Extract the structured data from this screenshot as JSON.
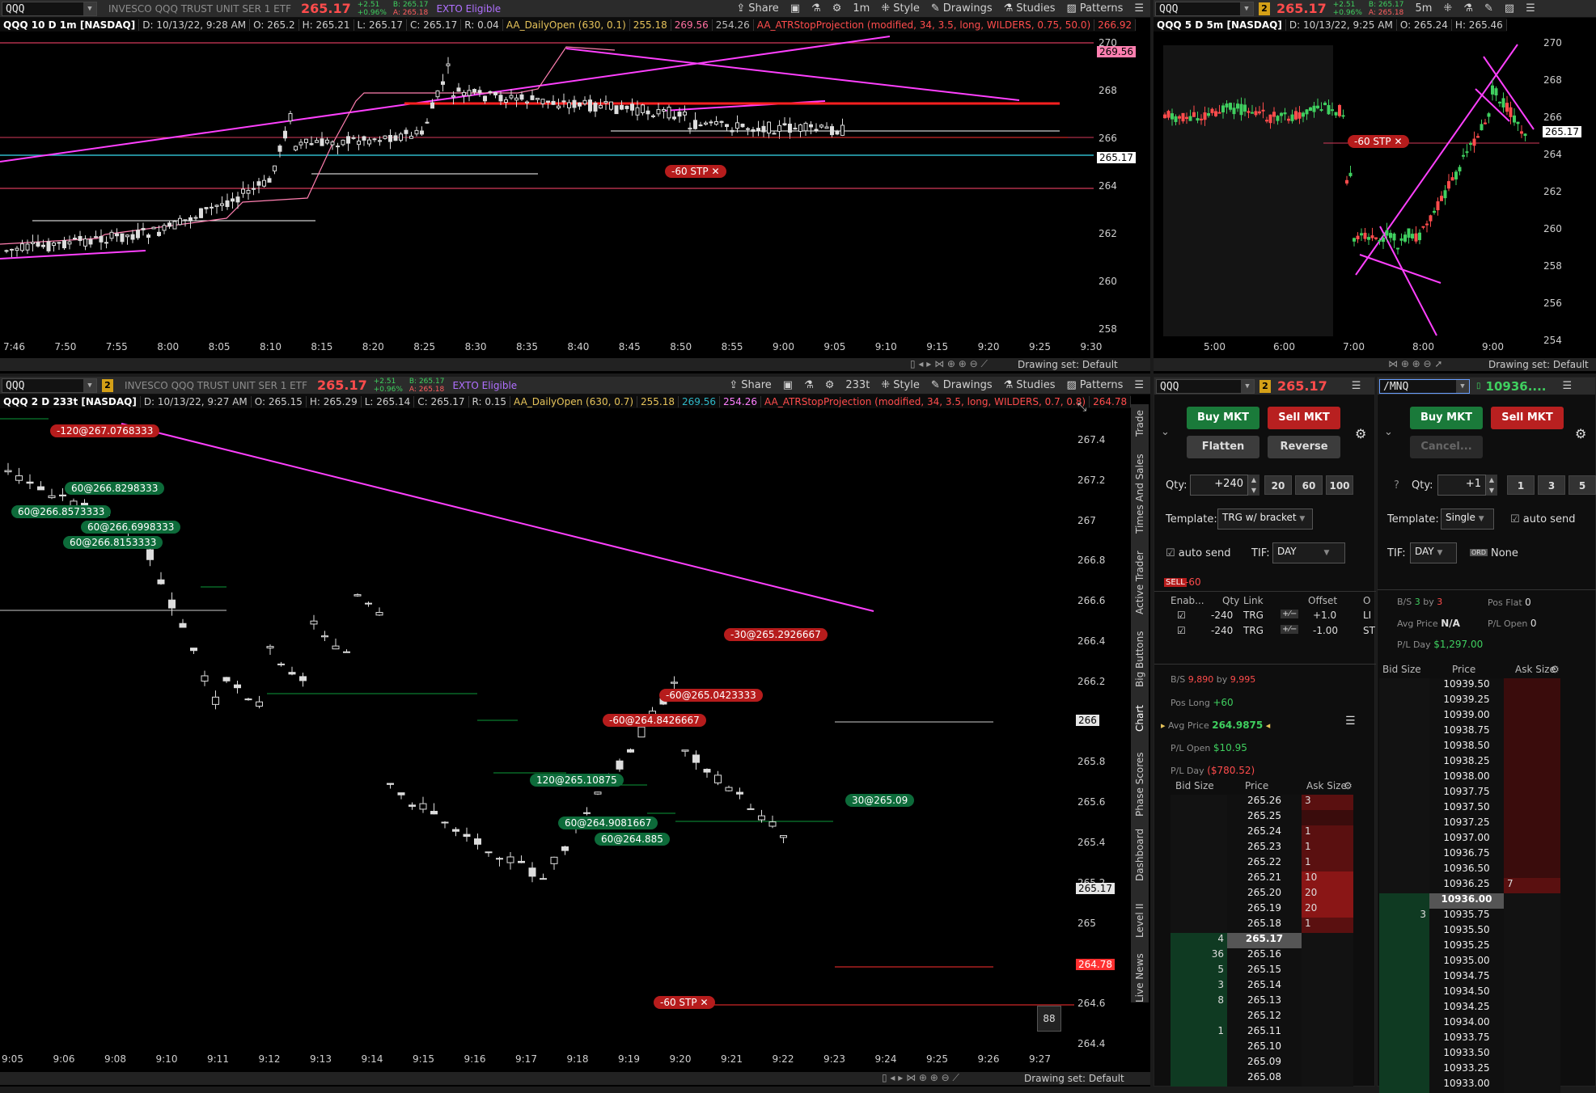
{
  "top_left": {
    "symbol": "QQQ",
    "description": "INVESCO QQQ TRUST UNIT SER 1 ETF",
    "last": "265.17",
    "change": "+2.51",
    "change_pct": "+0.96%",
    "bid": "B: 265.17",
    "ask": "A: 265.18",
    "exto": "EXTO Eligible",
    "toolbar": {
      "share": "Share",
      "interval": "1m",
      "style": "Style",
      "drawings": "Drawings",
      "studies": "Studies",
      "patterns": "Patterns"
    },
    "info": {
      "title": "QQQ 10 D 1m [NASDAQ]",
      "date": "D: 10/13/22, 9:28 AM",
      "open": "O: 265.2",
      "high": "H: 265.21",
      "low": "L: 265.17",
      "close": "C: 265.17",
      "range": "R: 0.04",
      "study1": "AA_DailyOpen (630, 0.1)",
      "s1v1": "255.18",
      "s1v2": "269.56",
      "s1v3": "254.26",
      "study2": "AA_ATRStopProjection (modified, 34, 3.5, long, WILDERS, 0.75, 50.0)",
      "s2v": "266.92"
    },
    "y_labels": [
      "270",
      "268",
      "266",
      "264",
      "262",
      "260",
      "258"
    ],
    "x_labels": [
      "7:46",
      "7:50",
      "7:55",
      "8:00",
      "8:05",
      "8:10",
      "8:15",
      "8:20",
      "8:25",
      "8:30",
      "8:35",
      "8:40",
      "8:45",
      "8:50",
      "8:55",
      "9:00",
      "9:05",
      "9:10",
      "9:15",
      "9:20",
      "9:25",
      "9:30"
    ],
    "price_tag_top": "269.56",
    "price_tag_last": "265.17",
    "stop_tag": "-60 STP",
    "drawing_set": "Drawing set: Default"
  },
  "top_right": {
    "symbol": "QQQ",
    "link": "2",
    "last": "265.17",
    "change": "+2.51",
    "change_pct": "+0.96%",
    "bid": "B: 265.17",
    "ask": "A: 265.18",
    "interval": "5m",
    "info": {
      "title": "QQQ 5 D 5m [NASDAQ]",
      "date": "D: 10/13/22, 9:25 AM",
      "open": "O: 265.24",
      "high": "H: 265.46"
    },
    "y_labels": [
      "270",
      "268",
      "266",
      "264",
      "262",
      "260",
      "258",
      "256",
      "254"
    ],
    "x_labels": [
      "5:00",
      "6:00",
      "7:00",
      "8:00",
      "9:00"
    ],
    "price_tag_last": "265.17",
    "stop_tag": "-60 STP",
    "drawing_set": "Drawing set: Default"
  },
  "bottom": {
    "symbol": "QQQ",
    "link": "2",
    "description": "INVESCO QQQ TRUST UNIT SER 1 ETF",
    "last": "265.17",
    "change": "+2.51",
    "change_pct": "+0.96%",
    "bid": "B: 265.17",
    "ask": "A: 265.18",
    "exto": "EXTO Eligible",
    "toolbar": {
      "share": "Share",
      "interval": "233t",
      "style": "Style",
      "drawings": "Drawings",
      "studies": "Studies",
      "patterns": "Patterns"
    },
    "info": {
      "title": "QQQ 2 D 233t [NASDAQ]",
      "date": "D: 10/13/22, 9:27 AM",
      "open": "O: 265.15",
      "high": "H: 265.29",
      "low": "L: 265.14",
      "close": "C: 265.17",
      "range": "R: 0.15",
      "study1": "AA_DailyOpen (630, 0.7)",
      "s1v1": "255.18",
      "s1v2": "269.56",
      "s1v3": "254.26",
      "study2": "AA_ATRStopProjection (modified, 34, 3.5, long, WILDERS, 0.7, 0.8)",
      "s2v": "264.78"
    },
    "y_labels": [
      "267.4",
      "267.2",
      "267",
      "266.8",
      "266.6",
      "266.4",
      "266.2",
      "266",
      "265.8",
      "265.6",
      "265.4",
      "265.2",
      "265",
      "264.8",
      "264.6",
      "264.4"
    ],
    "x_labels": [
      "9:05",
      "9:06",
      "9:08",
      "9:10",
      "9:11",
      "9:12",
      "9:13",
      "9:14",
      "9:15",
      "9:16",
      "9:17",
      "9:18",
      "9:19",
      "9:20",
      "9:21",
      "9:22",
      "9:23",
      "9:24",
      "9:25",
      "9:26",
      "9:27"
    ],
    "tag_266": "266",
    "tag_last": "265.17",
    "tag_stop": "264.78",
    "stop_tag": "-60 STP",
    "fills": [
      {
        "text": "-120@267.0768333",
        "kind": "r"
      },
      {
        "text": "60@266.8298333",
        "kind": "g"
      },
      {
        "text": "60@266.8573333",
        "kind": "g"
      },
      {
        "text": "60@266.6998333",
        "kind": "g"
      },
      {
        "text": "60@266.8153333",
        "kind": "g"
      },
      {
        "text": "-30@265.2926667",
        "kind": "r"
      },
      {
        "text": "-60@265.0423333",
        "kind": "r"
      },
      {
        "text": "-60@264.8426667",
        "kind": "r"
      },
      {
        "text": "120@265.10875",
        "kind": "g"
      },
      {
        "text": "30@265.09",
        "kind": "g"
      },
      {
        "text": "60@264.9081667",
        "kind": "g"
      },
      {
        "text": "60@264.885",
        "kind": "g"
      }
    ],
    "count_badge": "88",
    "drawing_set": "Drawing set: Default"
  },
  "side_tabs": [
    "Trade",
    "Times And Sales",
    "Active Trader",
    "Big Buttons",
    "Chart",
    "Phase Scores",
    "Dashboard",
    "Level II",
    "Live News"
  ],
  "trader_left": {
    "symbol": "QQQ",
    "link": "2",
    "last": "265.17",
    "buy": "Buy MKT",
    "sell": "Sell MKT",
    "flatten": "Flatten",
    "reverse": "Reverse",
    "qty_label": "Qty:",
    "qty": "+240",
    "qty_presets": [
      "20",
      "60",
      "100"
    ],
    "template_label": "Template:",
    "template": "TRG w/ bracket",
    "auto_send": "auto send",
    "tif_label": "TIF:",
    "tif": "DAY",
    "sell_badge": "SELL",
    "sell_qty": "-60",
    "order_table": {
      "headers": [
        "Enab...",
        "Qty",
        "Link",
        "Offset",
        "O"
      ],
      "rows": [
        {
          "qty": "-240",
          "link": "TRG",
          "offset": "+1.0",
          "o": "LI"
        },
        {
          "qty": "-240",
          "link": "TRG",
          "offset": "-1.00",
          "o": "ST"
        }
      ]
    },
    "bs": "B/S",
    "bs_buy": "9,890",
    "bs_by": "by",
    "bs_sell": "9,995",
    "pos_long_label": "Pos Long",
    "pos_long": "+60",
    "avg_price_label": "Avg Price",
    "avg_price": "264.9875",
    "pl_open_label": "P/L Open",
    "pl_open": "$10.95",
    "pl_day_label": "P/L Day",
    "pl_day": "($780.52)",
    "ladder_headers": [
      "Bid Size",
      "Price",
      "Ask Size"
    ],
    "ladder": [
      {
        "bid": "",
        "price": "265.26",
        "ask": "3"
      },
      {
        "bid": "",
        "price": "265.25",
        "ask": ""
      },
      {
        "bid": "",
        "price": "265.24",
        "ask": "1"
      },
      {
        "bid": "",
        "price": "265.23",
        "ask": "1"
      },
      {
        "bid": "",
        "price": "265.22",
        "ask": "1"
      },
      {
        "bid": "",
        "price": "265.21",
        "ask": "10"
      },
      {
        "bid": "",
        "price": "265.20",
        "ask": "20"
      },
      {
        "bid": "",
        "price": "265.19",
        "ask": "20"
      },
      {
        "bid": "",
        "price": "265.18",
        "ask": "1"
      },
      {
        "bid": "4",
        "price": "265.17",
        "ask": ""
      },
      {
        "bid": "36",
        "price": "265.16",
        "ask": ""
      },
      {
        "bid": "5",
        "price": "265.15",
        "ask": ""
      },
      {
        "bid": "3",
        "price": "265.14",
        "ask": ""
      },
      {
        "bid": "8",
        "price": "265.13",
        "ask": ""
      },
      {
        "bid": "",
        "price": "265.12",
        "ask": ""
      },
      {
        "bid": "1",
        "price": "265.11",
        "ask": ""
      },
      {
        "bid": "",
        "price": "265.10",
        "ask": ""
      },
      {
        "bid": "",
        "price": "265.09",
        "ask": ""
      },
      {
        "bid": "",
        "price": "265.08",
        "ask": ""
      }
    ]
  },
  "trader_right": {
    "symbol": "/MNQ",
    "last": "10936....",
    "buy": "Buy MKT",
    "sell": "Sell MKT",
    "cancel": "Cancel...",
    "qty_label": "Qty:",
    "qty": "+1",
    "qty_presets": [
      "1",
      "3",
      "5"
    ],
    "template_label": "Template:",
    "template": "Single",
    "auto_send": "auto send",
    "tif_label": "TIF:",
    "tif": "DAY",
    "ord_badge": "ORD",
    "ord_text": "None",
    "bs": "B/S",
    "bs_buy": "3",
    "bs_by": "by",
    "bs_sell": "3",
    "pos_flat_label": "Pos Flat",
    "pos_flat": "0",
    "avg_price_label": "Avg Price",
    "avg_price": "N/A",
    "pl_open_label": "P/L Open",
    "pl_open": "0",
    "pl_day_label": "P/L Day",
    "pl_day": "$1,297.00",
    "ladder_headers": [
      "Bid Size",
      "Price",
      "Ask Size"
    ],
    "ladder": [
      {
        "bid": "",
        "price": "10939.50",
        "ask": ""
      },
      {
        "bid": "",
        "price": "10939.25",
        "ask": ""
      },
      {
        "bid": "",
        "price": "10939.00",
        "ask": ""
      },
      {
        "bid": "",
        "price": "10938.75",
        "ask": ""
      },
      {
        "bid": "",
        "price": "10938.50",
        "ask": ""
      },
      {
        "bid": "",
        "price": "10938.25",
        "ask": ""
      },
      {
        "bid": "",
        "price": "10938.00",
        "ask": ""
      },
      {
        "bid": "",
        "price": "10937.75",
        "ask": ""
      },
      {
        "bid": "",
        "price": "10937.50",
        "ask": ""
      },
      {
        "bid": "",
        "price": "10937.25",
        "ask": ""
      },
      {
        "bid": "",
        "price": "10937.00",
        "ask": ""
      },
      {
        "bid": "",
        "price": "10936.75",
        "ask": ""
      },
      {
        "bid": "",
        "price": "10936.50",
        "ask": ""
      },
      {
        "bid": "",
        "price": "10936.25",
        "ask": "7"
      },
      {
        "bid": "",
        "price": "10936.00",
        "ask": ""
      },
      {
        "bid": "3",
        "price": "10935.75",
        "ask": ""
      },
      {
        "bid": "",
        "price": "10935.50",
        "ask": ""
      },
      {
        "bid": "",
        "price": "10935.25",
        "ask": ""
      },
      {
        "bid": "",
        "price": "10935.00",
        "ask": ""
      },
      {
        "bid": "",
        "price": "10934.75",
        "ask": ""
      },
      {
        "bid": "",
        "price": "10934.50",
        "ask": ""
      },
      {
        "bid": "",
        "price": "10934.25",
        "ask": ""
      },
      {
        "bid": "",
        "price": "10934.00",
        "ask": ""
      },
      {
        "bid": "",
        "price": "10933.75",
        "ask": ""
      },
      {
        "bid": "",
        "price": "10933.50",
        "ask": ""
      },
      {
        "bid": "",
        "price": "10933.25",
        "ask": ""
      },
      {
        "bid": "",
        "price": "10933.00",
        "ask": ""
      }
    ]
  },
  "colors": {
    "up": "#3fcf5f",
    "down": "#ff4c4c",
    "magenta": "#ff40ff",
    "pink": "#ff7fb0",
    "cyan": "#2fb8c8"
  }
}
